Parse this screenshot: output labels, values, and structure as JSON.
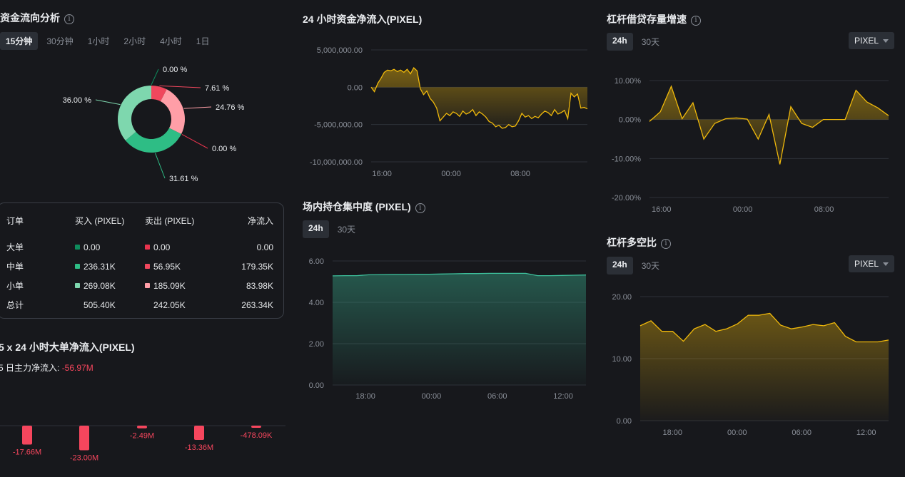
{
  "panel_flow": {
    "title": "资金流向分析",
    "tabs": [
      {
        "label": "15分钟",
        "active": true
      },
      {
        "label": "30分钟",
        "active": false
      },
      {
        "label": "1小时",
        "active": false
      },
      {
        "label": "2小时",
        "active": false
      },
      {
        "label": "4小时",
        "active": false
      },
      {
        "label": "1日",
        "active": false
      }
    ]
  },
  "order_table": {
    "headers": [
      "订单",
      "买入 (PIXEL)",
      "卖出 (PIXEL)",
      "净流入"
    ],
    "rows": [
      {
        "label": "大单",
        "buy": "0.00",
        "sell": "0.00",
        "net": "0.00",
        "buy_color": "#0e8b5c",
        "sell_color": "#e8334d"
      },
      {
        "label": "中单",
        "buy": "236.31K",
        "sell": "56.95K",
        "net": "179.35K",
        "buy_color": "#2ebd85",
        "sell_color": "#f0475d"
      },
      {
        "label": "小单",
        "buy": "269.08K",
        "sell": "185.09K",
        "net": "83.98K",
        "buy_color": "#7ed7ae",
        "sell_color": "#ff9ea7"
      }
    ],
    "total": {
      "label": "总计",
      "buy": "505.40K",
      "sell": "242.05K",
      "net": "263.34K"
    }
  },
  "panel_5day": {
    "title": "5 x 24 小时大单净流入(PIXEL)",
    "subtitle_label": "5 日主力净流入:",
    "subtitle_value": "-56.97M"
  },
  "panel_24h": {
    "title": "24 小时资金净流入(PIXEL)"
  },
  "panel_conc": {
    "title": "场内持仓集中度 (PIXEL)",
    "tabs": [
      {
        "label": "24h",
        "active": true
      },
      {
        "label": "30天",
        "active": false
      }
    ]
  },
  "panel_lev": {
    "title": "杠杆借贷存量增速",
    "tabs": [
      {
        "label": "24h",
        "active": true
      },
      {
        "label": "30天",
        "active": false
      }
    ],
    "select_value": "PIXEL"
  },
  "panel_ls": {
    "title": "杠杆多空比",
    "tabs": [
      {
        "label": "24h",
        "active": true
      },
      {
        "label": "30天",
        "active": false
      }
    ],
    "select_value": "PIXEL"
  },
  "colors": {
    "accent_yellow": "#f0b90b",
    "green": "#2ebd85",
    "red": "#f6465d",
    "teal_line": "#3dbf9b"
  },
  "chart_data": [
    {
      "id": "donut",
      "type": "pie",
      "slices": [
        {
          "label": "0.00 %",
          "value": 0.0001,
          "color": "#0e8b5c"
        },
        {
          "label": "7.61 %",
          "value": 7.61,
          "color": "#f0475d"
        },
        {
          "label": "24.76 %",
          "value": 24.76,
          "color": "#ff9ea7"
        },
        {
          "label": "0.00 %",
          "value": 0.0001,
          "color": "#e8334d"
        },
        {
          "label": "31.61 %",
          "value": 31.61,
          "color": "#2ebd85"
        },
        {
          "label": "36.00 %",
          "value": 36.0,
          "color": "#7ed7ae"
        }
      ]
    },
    {
      "id": "fiveday",
      "type": "bar",
      "values": [
        -17.66,
        -23.0,
        -2.49,
        -13.36,
        -0.478
      ],
      "labels": [
        "-17.66M",
        "-23.00M",
        "-2.49M",
        "-13.36M",
        "-478.09K"
      ],
      "color": "#f6465d"
    },
    {
      "id": "net24h",
      "type": "area",
      "ylim": [
        -10000000,
        5000000
      ],
      "yticks": [
        5000000,
        0,
        -5000000,
        -10000000
      ],
      "ytick_labels": [
        "5,000,000.00",
        "0.00",
        "-5,000,000.00",
        "-10,000,000.00"
      ],
      "xtick_labels": [
        "16:00",
        "00:00",
        "08:00"
      ],
      "xtick_positions": [
        0.05,
        0.37,
        0.69
      ],
      "values": [
        0.0,
        -0.6,
        0.5,
        1.2,
        2.0,
        2.3,
        2.2,
        2.4,
        2.1,
        2.3,
        2.0,
        2.4,
        1.8,
        2.6,
        2.2,
        -0.2,
        -1.0,
        -0.5,
        -1.5,
        -2.0,
        -2.8,
        -4.5,
        -4.0,
        -3.5,
        -3.8,
        -3.3,
        -3.5,
        -3.9,
        -3.2,
        -3.6,
        -3.4,
        -3.0,
        -3.8,
        -3.3,
        -3.6,
        -4.0,
        -4.6,
        -4.8,
        -5.3,
        -5.1,
        -5.5,
        -5.4,
        -5.0,
        -5.3,
        -5.2,
        -4.5,
        -3.5,
        -4.0,
        -3.8,
        -4.2,
        -3.9,
        -4.1,
        -3.6,
        -3.2,
        -3.4,
        -3.8,
        -3.0,
        -3.6,
        -3.4,
        -3.1,
        -4.2,
        -0.8,
        -1.3,
        -0.9,
        -2.8,
        -2.7,
        -2.9
      ],
      "color": "#f0b90b"
    },
    {
      "id": "concentration",
      "type": "area",
      "ylim": [
        0,
        6
      ],
      "yticks": [
        0,
        2,
        4,
        6
      ],
      "ytick_labels": [
        "0.00",
        "2.00",
        "4.00",
        "6.00"
      ],
      "xtick_labels": [
        "18:00",
        "00:00",
        "06:00",
        "12:00"
      ],
      "xtick_positions": [
        0.13,
        0.39,
        0.65,
        0.91
      ],
      "values": [
        5.28,
        5.29,
        5.29,
        5.33,
        5.34,
        5.35,
        5.35,
        5.36,
        5.36,
        5.37,
        5.38,
        5.39,
        5.39,
        5.4,
        5.4,
        5.4,
        5.4,
        5.29,
        5.29,
        5.3,
        5.31,
        5.32
      ],
      "color": "#3dbf9b"
    },
    {
      "id": "leverage_growth",
      "type": "line",
      "ylim": [
        -20,
        12
      ],
      "yticks": [
        10,
        0,
        -10,
        -20
      ],
      "ytick_labels": [
        "10.00%",
        "0.00%",
        "-10.00%",
        "-20.00%"
      ],
      "xtick_labels": [
        "16:00",
        "00:00",
        "08:00"
      ],
      "xtick_positions": [
        0.05,
        0.39,
        0.73
      ],
      "values": [
        -0.5,
        2.0,
        8.5,
        0.2,
        4.3,
        -5.0,
        -1.0,
        0.2,
        0.4,
        0.1,
        -5.0,
        1.3,
        -11.5,
        3.3,
        -1.0,
        -2.0,
        0.0,
        0.0,
        0.0,
        7.5,
        4.5,
        3.0,
        1.0
      ],
      "color": "#f0b90b"
    },
    {
      "id": "long_short",
      "type": "area",
      "ylim": [
        0,
        20
      ],
      "yticks": [
        0,
        10,
        20
      ],
      "ytick_labels": [
        "0.00",
        "10.00",
        "20.00"
      ],
      "xtick_labels": [
        "18:00",
        "00:00",
        "06:00",
        "12:00"
      ],
      "xtick_positions": [
        0.13,
        0.39,
        0.65,
        0.91
      ],
      "values": [
        15.3,
        16.1,
        14.4,
        14.4,
        12.8,
        14.8,
        15.5,
        14.4,
        14.8,
        15.6,
        17.0,
        17.0,
        17.3,
        15.4,
        14.8,
        15.1,
        15.5,
        15.3,
        15.8,
        13.6,
        12.7,
        12.7,
        12.7,
        13.0
      ],
      "color": "#f0b90b"
    }
  ]
}
